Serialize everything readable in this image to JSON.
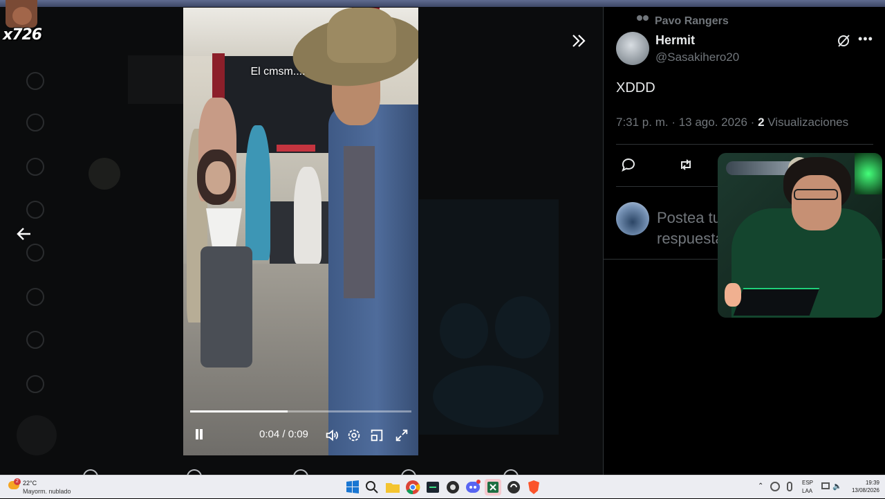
{
  "badge": {
    "label": "x726"
  },
  "video": {
    "caption": "El cmsm....",
    "time": "0:04 / 0:09",
    "progress": 0.44
  },
  "panel": {
    "community": "Pavo Rangers",
    "user_name": "Hermit",
    "user_handle": "@Sasakihero20",
    "tweet_text": "XDDD",
    "timestamp": "7:31 p. m. · 13 ago. 2026 · ",
    "views_count": "2",
    "views_label": " Visualizaciones",
    "reply_placeholder": "Postea tu respuesta"
  },
  "taskbar": {
    "weather_temp": "22°C",
    "weather_desc": "Mayorm. nublado",
    "weather_alert": "2",
    "lang_top": "ESP",
    "lang_bottom": "LAA",
    "time": "19:39",
    "date": "13/08/2026"
  },
  "colors": {
    "text_primary": "#e7e9ea",
    "text_secondary": "#71767b",
    "divider": "#2f3336",
    "taskbar_bg": "#ecedf2"
  }
}
